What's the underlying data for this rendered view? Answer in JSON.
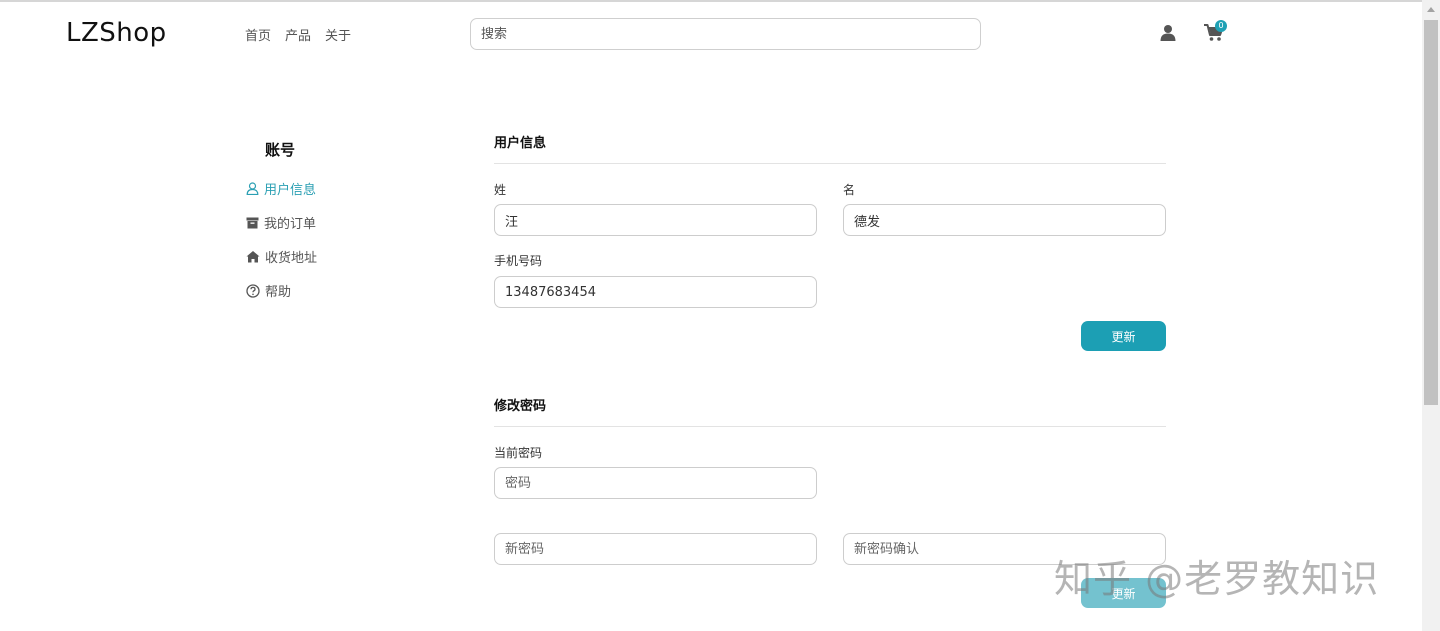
{
  "header": {
    "logo": "LZShop",
    "nav": [
      "首页",
      "产品",
      "关于"
    ],
    "search_placeholder": "搜索",
    "cart_count": "0",
    "user_icon": "user-icon",
    "cart_icon": "cart-icon"
  },
  "sidebar": {
    "title": "账号",
    "items": [
      {
        "label": "用户信息",
        "icon": "user-outline-icon",
        "active": true
      },
      {
        "label": "我的订单",
        "icon": "archive-box-icon",
        "active": false
      },
      {
        "label": "收货地址",
        "icon": "home-icon",
        "active": false
      },
      {
        "label": "帮助",
        "icon": "question-circle-icon",
        "active": false
      }
    ]
  },
  "profile": {
    "title": "用户信息",
    "last_name_label": "姓",
    "last_name_value": "汪",
    "first_name_label": "名",
    "first_name_value": "德发",
    "phone_label": "手机号码",
    "phone_value": "13487683454",
    "update_label": "更新"
  },
  "password": {
    "title": "修改密码",
    "current_label": "当前密码",
    "current_placeholder": "密码",
    "new_placeholder": "新密码",
    "confirm_placeholder": "新密码确认",
    "update_label": "更新"
  },
  "watermark": "知乎 @老罗教知识",
  "colors": {
    "accent": "#1c9fb4",
    "text": "#222222",
    "muted": "#555555"
  }
}
